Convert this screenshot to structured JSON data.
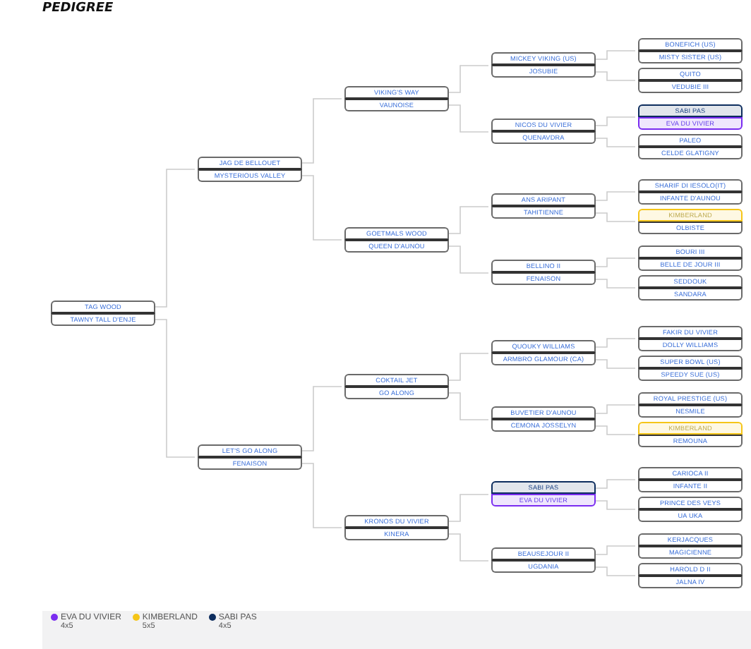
{
  "title": "PEDIGREE",
  "tree": {
    "sire": {
      "name": "TAG WOOD"
    },
    "dam": {
      "name": "TAWNY TALL D'ENJE"
    },
    "children": [
      {
        "sire": {
          "name": "JAG DE BELLOUET"
        },
        "dam": {
          "name": "MYSTERIOUS VALLEY"
        },
        "children": [
          {
            "sire": {
              "name": "VIKING'S WAY"
            },
            "dam": {
              "name": "VAUNOISE"
            },
            "children": [
              {
                "sire": {
                  "name": "MICKEY VIKING (US)"
                },
                "dam": {
                  "name": "JOSUBIE"
                },
                "children": [
                  {
                    "sire": {
                      "name": "BONEFICH (US)"
                    },
                    "dam": {
                      "name": "MISTY SISTER (US)"
                    }
                  },
                  {
                    "sire": {
                      "name": "QUITO"
                    },
                    "dam": {
                      "name": "VEDUBIE III"
                    }
                  }
                ]
              },
              {
                "sire": {
                  "name": "NICOS DU VIVIER"
                },
                "dam": {
                  "name": "QUENAVDRA"
                },
                "children": [
                  {
                    "sire": {
                      "name": "SABI PAS",
                      "color": "#0d2d5e"
                    },
                    "dam": {
                      "name": "EVA DU VIVIER",
                      "color": "#7a2cf0"
                    }
                  },
                  {
                    "sire": {
                      "name": "PALEO"
                    },
                    "dam": {
                      "name": "CELDE GLATIGNY"
                    }
                  }
                ]
              }
            ]
          },
          {
            "sire": {
              "name": "GOETMALS WOOD"
            },
            "dam": {
              "name": "QUEEN D'AUNOU"
            },
            "children": [
              {
                "sire": {
                  "name": "ANS ARIPANT"
                },
                "dam": {
                  "name": "TAHITIENNE"
                },
                "children": [
                  {
                    "sire": {
                      "name": "SHARIF DI IESOLO(IT)"
                    },
                    "dam": {
                      "name": "INFANTE D'AUNOU"
                    }
                  },
                  {
                    "sire": {
                      "name": "KIMBERLAND",
                      "color": "#f5c518"
                    },
                    "dam": {
                      "name": "OLBISTE"
                    }
                  }
                ]
              },
              {
                "sire": {
                  "name": "BELLINO II"
                },
                "dam": {
                  "name": "FENAISON"
                },
                "children": [
                  {
                    "sire": {
                      "name": "BOURI III"
                    },
                    "dam": {
                      "name": "BELLE DE JOUR III"
                    }
                  },
                  {
                    "sire": {
                      "name": "SEDDOUK"
                    },
                    "dam": {
                      "name": "SANDARA"
                    }
                  }
                ]
              }
            ]
          }
        ]
      },
      {
        "sire": {
          "name": "LET'S GO ALONG"
        },
        "dam": {
          "name": "FENAISON"
        },
        "children": [
          {
            "sire": {
              "name": "COKTAIL JET"
            },
            "dam": {
              "name": "GO ALONG"
            },
            "children": [
              {
                "sire": {
                  "name": "QUOUKY WILLIAMS"
                },
                "dam": {
                  "name": "ARMBRO GLAMOUR (CA)"
                },
                "children": [
                  {
                    "sire": {
                      "name": "FAKIR DU VIVIER"
                    },
                    "dam": {
                      "name": "DOLLY WILLIAMS"
                    }
                  },
                  {
                    "sire": {
                      "name": "SUPER BOWL (US)"
                    },
                    "dam": {
                      "name": "SPEEDY SUE (US)"
                    }
                  }
                ]
              },
              {
                "sire": {
                  "name": "BUVETIER D'AUNOU"
                },
                "dam": {
                  "name": "CEMONA JOSSELYN"
                },
                "children": [
                  {
                    "sire": {
                      "name": "ROYAL PRESTIGE (US)"
                    },
                    "dam": {
                      "name": "NESMILE"
                    }
                  },
                  {
                    "sire": {
                      "name": "KIMBERLAND",
                      "color": "#f5c518"
                    },
                    "dam": {
                      "name": "REMOUNA"
                    }
                  }
                ]
              }
            ]
          },
          {
            "sire": {
              "name": "KRONOS DU VIVIER"
            },
            "dam": {
              "name": "KINERA"
            },
            "children": [
              {
                "sire": {
                  "name": "SABI PAS",
                  "color": "#0d2d5e"
                },
                "dam": {
                  "name": "EVA DU VIVIER",
                  "color": "#7a2cf0"
                },
                "children": [
                  {
                    "sire": {
                      "name": "CARIOCA II"
                    },
                    "dam": {
                      "name": "INFANTE II"
                    }
                  },
                  {
                    "sire": {
                      "name": "PRINCE DES VEYS"
                    },
                    "dam": {
                      "name": "UA UKA"
                    }
                  }
                ]
              },
              {
                "sire": {
                  "name": "BEAUSEJOUR II"
                },
                "dam": {
                  "name": "UGDANIA"
                },
                "children": [
                  {
                    "sire": {
                      "name": "KERJACQUES"
                    },
                    "dam": {
                      "name": "MAGICIENNE"
                    }
                  },
                  {
                    "sire": {
                      "name": "HAROLD D II"
                    },
                    "dam": {
                      "name": "JALNA IV"
                    }
                  }
                ]
              }
            ]
          }
        ]
      }
    ]
  },
  "legend": [
    {
      "name": "EVA DU VIVIER",
      "color": "#7a2cf0",
      "value": "4x5"
    },
    {
      "name": "KIMBERLAND",
      "color": "#f5c518",
      "value": "5x5"
    },
    {
      "name": "SABI PAS",
      "color": "#0d2d5e",
      "value": "4x5"
    }
  ]
}
